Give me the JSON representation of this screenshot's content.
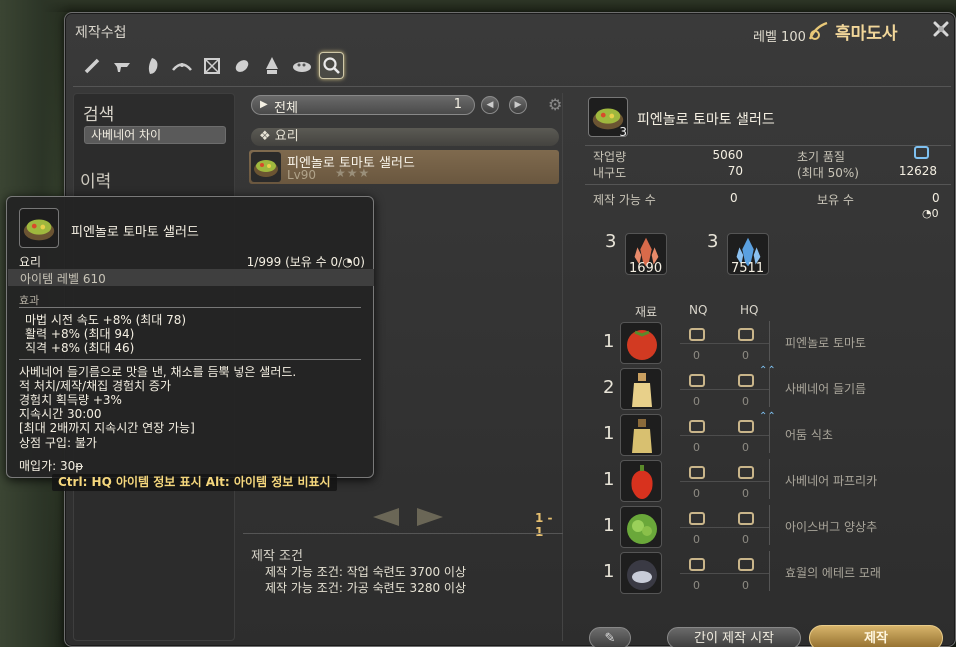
{
  "window": {
    "title": "제작수첩",
    "level_label": "레벨 100",
    "job_name": "흑마도사"
  },
  "toolbar": {
    "tools": [
      "carpenter-icon",
      "blacksmith-icon",
      "armorer-icon",
      "goldsmith-icon",
      "leatherworker-icon",
      "weaver-icon",
      "alchemist-icon",
      "culinarian-icon",
      "search-icon"
    ]
  },
  "left": {
    "search_label": "검색",
    "search_value": "사베네어 차이",
    "history_label": "이력"
  },
  "middle": {
    "filter_label": "전체",
    "filter_count": "1",
    "category": "요리",
    "recipe": {
      "name": "피엔놀로 토마토 샐러드",
      "level": "Lv90",
      "stars": "★★★"
    },
    "page_indicator": "1 - 1",
    "conditions_title": "제작 조건",
    "conditions": [
      "제작 가능 조건: 작업 숙련도 3700 이상",
      "제작 가능 조건: 가공 숙련도 3280 이상"
    ]
  },
  "right": {
    "item_name": "피엔놀로 토마토 샐러드",
    "yield": "3",
    "progress_label": "작업량",
    "progress_value": "5060",
    "durability_label": "내구도",
    "durability_value": "70",
    "initial_quality_label": "초기 품질",
    "max_label": "(최대 50%)",
    "max_value": "12628",
    "craftable_label": "제작 가능 수",
    "craftable_value": "0",
    "owned_label": "보유 수",
    "owned_value": "0",
    "owned_hq": "0",
    "crystals": [
      {
        "need": "3",
        "have": "1690",
        "color": "#d86a4a"
      },
      {
        "need": "3",
        "have": "7511",
        "color": "#5aa0e0"
      }
    ],
    "mat_header": {
      "material": "재료",
      "nq": "NQ",
      "hq": "HQ"
    },
    "materials": [
      {
        "need": "1",
        "name": "피엔놀로 토마토",
        "nq": "0",
        "hq": "0",
        "hq_up": false,
        "icon": "tomato-icon"
      },
      {
        "need": "2",
        "name": "사베네어 들기름",
        "nq": "0",
        "hq": "0",
        "hq_up": true,
        "icon": "oil-bottle-icon"
      },
      {
        "need": "1",
        "name": "어둠 식초",
        "nq": "0",
        "hq": "0",
        "hq_up": true,
        "icon": "vinegar-bottle-icon"
      },
      {
        "need": "1",
        "name": "사베네어 파프리카",
        "nq": "0",
        "hq": "0",
        "hq_up": false,
        "icon": "paprika-icon"
      },
      {
        "need": "1",
        "name": "아이스버그 양상추",
        "nq": "0",
        "hq": "0",
        "hq_up": false,
        "icon": "lettuce-icon"
      },
      {
        "need": "1",
        "name": "효월의 에테르 모래",
        "nq": "0",
        "hq": "0",
        "hq_up": false,
        "icon": "aether-sand-icon"
      }
    ],
    "quick_synth": "간이 제작 시작",
    "craft": "제작"
  },
  "tooltip": {
    "name": "피엔놀로 토마토 샐러드",
    "category": "요리",
    "stack": "1/999 (보유 수 0/",
    "stack_hq": "0)",
    "item_level": "아이템 레벨 610",
    "effect_title": "효과",
    "effects": [
      "마법 시전 속도 +8% (최대 78)",
      "활력 +8% (최대 94)",
      "직격 +8% (최대 46)"
    ],
    "desc": [
      "사베네어 들기름으로 맛을 낸, 채소를 듬뿍 넣은 샐러드.",
      "적 처치/제작/채집 경험치 증가",
      "경험치 획득량 +3%",
      "지속시간 30:00",
      "[최대 2배까지 지속시간 연장 가능]",
      "상점 구입: 불가"
    ],
    "sell_price": "매입가: 30",
    "hint": "Ctrl: HQ 아이템 정보 표시 Alt: 아이템 정보 비표시"
  }
}
